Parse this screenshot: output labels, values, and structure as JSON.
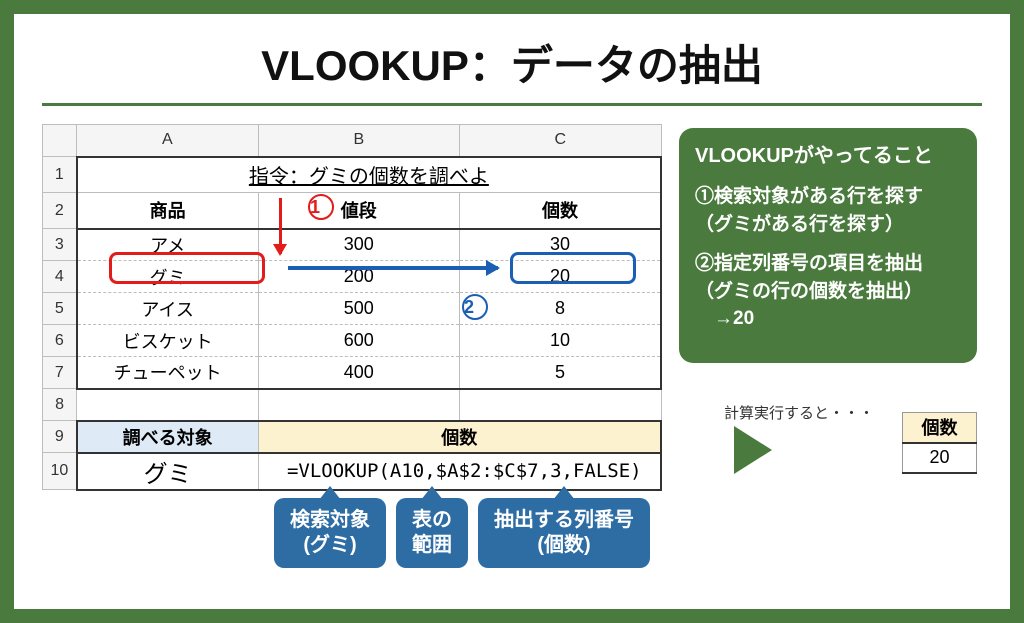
{
  "title": "VLOOKUP：データの抽出",
  "sheet": {
    "cols": [
      "A",
      "B",
      "C"
    ],
    "rows": [
      "1",
      "2",
      "3",
      "4",
      "5",
      "6",
      "7",
      "8",
      "9",
      "10"
    ],
    "instruction": "指令：グミの個数を調べよ",
    "headers": {
      "A": "商品",
      "B": "値段",
      "C": "個数"
    },
    "data": [
      {
        "a": "アメ",
        "b": "300",
        "c": "30"
      },
      {
        "a": "グミ",
        "b": "200",
        "c": "20"
      },
      {
        "a": "アイス",
        "b": "500",
        "c": "8"
      },
      {
        "a": "ビスケット",
        "b": "600",
        "c": "10"
      },
      {
        "a": "チューペット",
        "b": "400",
        "c": "5"
      }
    ],
    "lookup_header_a": "調べる対象",
    "lookup_header_bc": "個数",
    "lookup_value": "グミ",
    "formula": "=VLOOKUP(A10,$A$2:$C$7,3,FALSE)"
  },
  "markers": {
    "one": "1",
    "two": "2"
  },
  "panel": {
    "title": "VLOOKUPがやってること",
    "p1a": "①検索対象がある行を探す",
    "p1b": "（グミがある行を探す）",
    "p2a": "②指定列番号の項目を抽出",
    "p2b": "（グミの行の個数を抽出）",
    "p2c": "　→20"
  },
  "result": {
    "caption": "計算実行すると・・・",
    "header": "個数",
    "value": "20"
  },
  "callouts": {
    "c1a": "検索対象",
    "c1b": "(グミ)",
    "c2a": "表の",
    "c2b": "範囲",
    "c3a": "抽出する列番号",
    "c3b": "(個数)"
  }
}
